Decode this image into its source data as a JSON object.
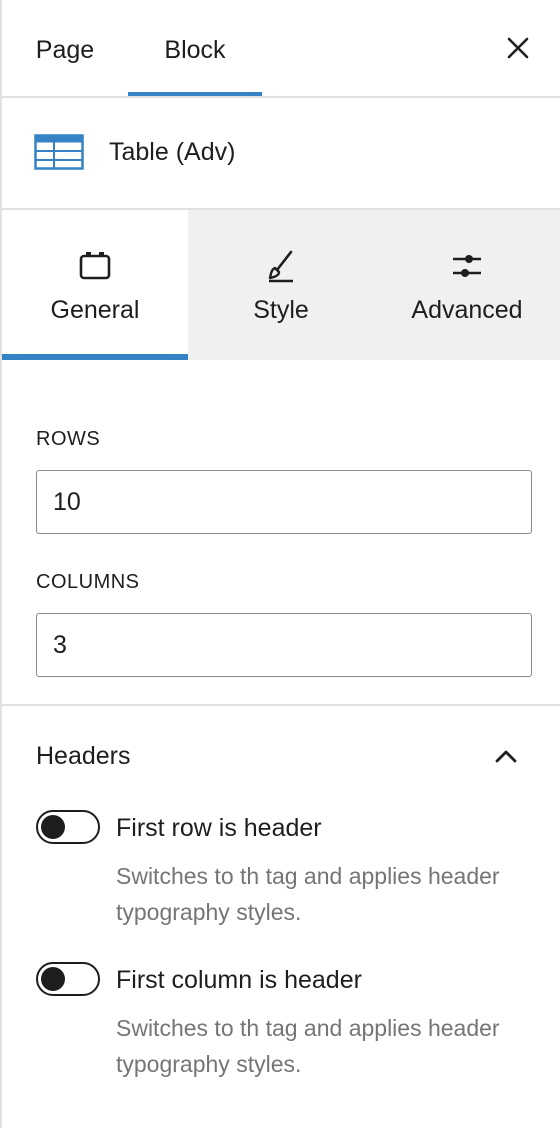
{
  "top_tabs": {
    "page": "Page",
    "block": "Block"
  },
  "block": {
    "name": "Table (Adv)",
    "icon": "table-icon"
  },
  "inspector_tabs": [
    {
      "label": "General",
      "icon": "settings-box-icon",
      "active": true
    },
    {
      "label": "Style",
      "icon": "brush-icon",
      "active": false
    },
    {
      "label": "Advanced",
      "icon": "sliders-icon",
      "active": false
    }
  ],
  "fields": {
    "rows": {
      "label": "ROWS",
      "value": "10"
    },
    "columns": {
      "label": "COLUMNS",
      "value": "3"
    }
  },
  "headers": {
    "title": "Headers",
    "first_row": {
      "label": "First row is header",
      "help": "Switches to th tag and applies header typography styles.",
      "checked": false
    },
    "first_column": {
      "label": "First column is header",
      "help": "Switches to th tag and applies header typography styles.",
      "checked": false
    }
  },
  "colors": {
    "accent": "#3582c4",
    "table_icon": "#3582c4",
    "muted_text": "#757575"
  }
}
